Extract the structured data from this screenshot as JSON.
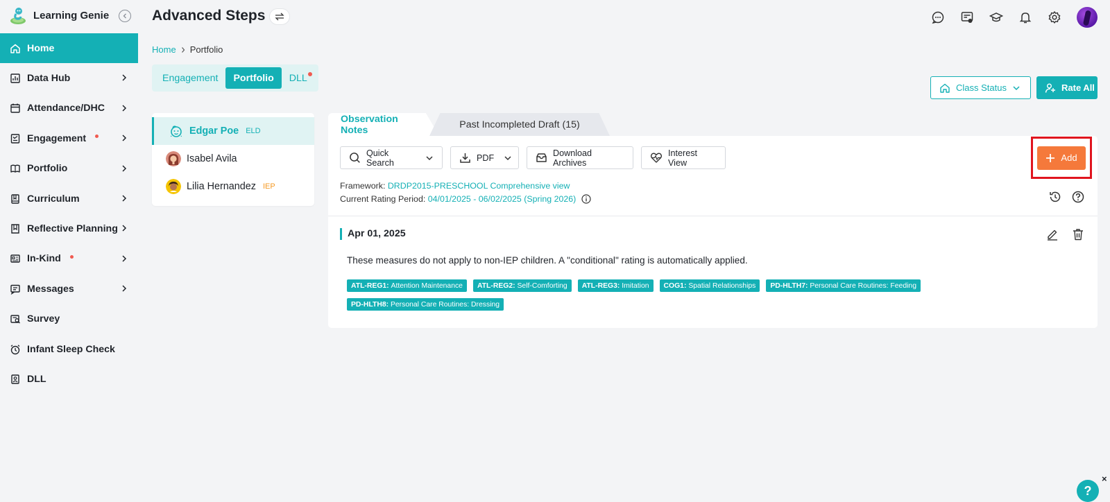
{
  "brand": {
    "name": "Learning Genie"
  },
  "sidebar": {
    "items": [
      {
        "label": "Home",
        "icon": "home-icon",
        "active": true,
        "dot": false,
        "chevron": false
      },
      {
        "label": "Data Hub",
        "icon": "chart-icon",
        "active": false,
        "dot": false,
        "chevron": true
      },
      {
        "label": "Attendance/DHC",
        "icon": "calendar-icon",
        "active": false,
        "dot": false,
        "chevron": true
      },
      {
        "label": "Engagement",
        "icon": "engagement-icon",
        "active": false,
        "dot": true,
        "chevron": true
      },
      {
        "label": "Portfolio",
        "icon": "portfolio-icon",
        "active": false,
        "dot": false,
        "chevron": true
      },
      {
        "label": "Curriculum",
        "icon": "book-icon",
        "active": false,
        "dot": false,
        "chevron": true
      },
      {
        "label": "Reflective Planning",
        "icon": "planning-icon",
        "active": false,
        "dot": false,
        "chevron": true
      },
      {
        "label": "In-Kind",
        "icon": "inkind-icon",
        "active": false,
        "dot": true,
        "chevron": true
      },
      {
        "label": "Messages",
        "icon": "message-icon",
        "active": false,
        "dot": false,
        "chevron": true
      },
      {
        "label": "Survey",
        "icon": "survey-icon",
        "active": false,
        "dot": false,
        "chevron": false
      },
      {
        "label": "Infant Sleep Check",
        "icon": "alarm-icon",
        "active": false,
        "dot": false,
        "chevron": false
      },
      {
        "label": "DLL",
        "icon": "dll-icon",
        "active": false,
        "dot": false,
        "chevron": false
      }
    ]
  },
  "header": {
    "title": "Advanced Steps",
    "icons": [
      "chat-icon",
      "profile-card-icon",
      "graduation-cap-icon",
      "bell-icon",
      "gear-icon",
      "avatar"
    ]
  },
  "breadcrumb": {
    "home": "Home",
    "current": "Portfolio"
  },
  "segment_tabs": [
    {
      "label": "Engagement",
      "active": false,
      "dot": false
    },
    {
      "label": "Portfolio",
      "active": true,
      "dot": false
    },
    {
      "label": "DLL",
      "active": false,
      "dot": true
    }
  ],
  "actions": {
    "class_status": "Class Status",
    "rate_all": "Rate All"
  },
  "children": [
    {
      "name": "Edgar Poe",
      "tag": "ELD",
      "tag_type": "eld",
      "active": true
    },
    {
      "name": "Isabel Avila",
      "tag": "",
      "tag_type": "",
      "active": false
    },
    {
      "name": "Lilia Hernandez",
      "tag": "IEP",
      "tag_type": "iep",
      "active": false
    }
  ],
  "tabs": {
    "active": "Observation Notes",
    "inactive": "Past Incompleted Draft (15)"
  },
  "toolbar": {
    "quick_search": "Quick Search",
    "pdf": "PDF",
    "download_archives": "Download Archives",
    "interest_view": "Interest View",
    "add": "Add"
  },
  "meta": {
    "framework_label": "Framework:",
    "framework_value": "DRDP2015-PRESCHOOL Comprehensive view",
    "rating_label": "Current Rating Period:",
    "rating_value": "04/01/2025 - 06/02/2025 (Spring 2026)"
  },
  "note": {
    "date": "Apr 01, 2025",
    "text": "These measures do not apply to non-IEP children. A \"conditional\" rating is automatically applied.",
    "tags": [
      {
        "code": "ATL-REG1:",
        "name": "Attention Maintenance"
      },
      {
        "code": "ATL-REG2:",
        "name": "Self-Comforting"
      },
      {
        "code": "ATL-REG3:",
        "name": "Imitation"
      },
      {
        "code": "COG1:",
        "name": "Spatial Relationships"
      },
      {
        "code": "PD-HLTH7:",
        "name": "Personal Care Routines: Feeding"
      },
      {
        "code": "PD-HLTH8:",
        "name": "Personal Care Routines: Dressing"
      }
    ]
  },
  "help": {
    "label": "?",
    "close": "×"
  },
  "colors": {
    "accent": "#14b0b5",
    "add": "#f5793b",
    "highlight": "#e0141e",
    "dot": "#f05a50",
    "iep": "#f59a23"
  }
}
